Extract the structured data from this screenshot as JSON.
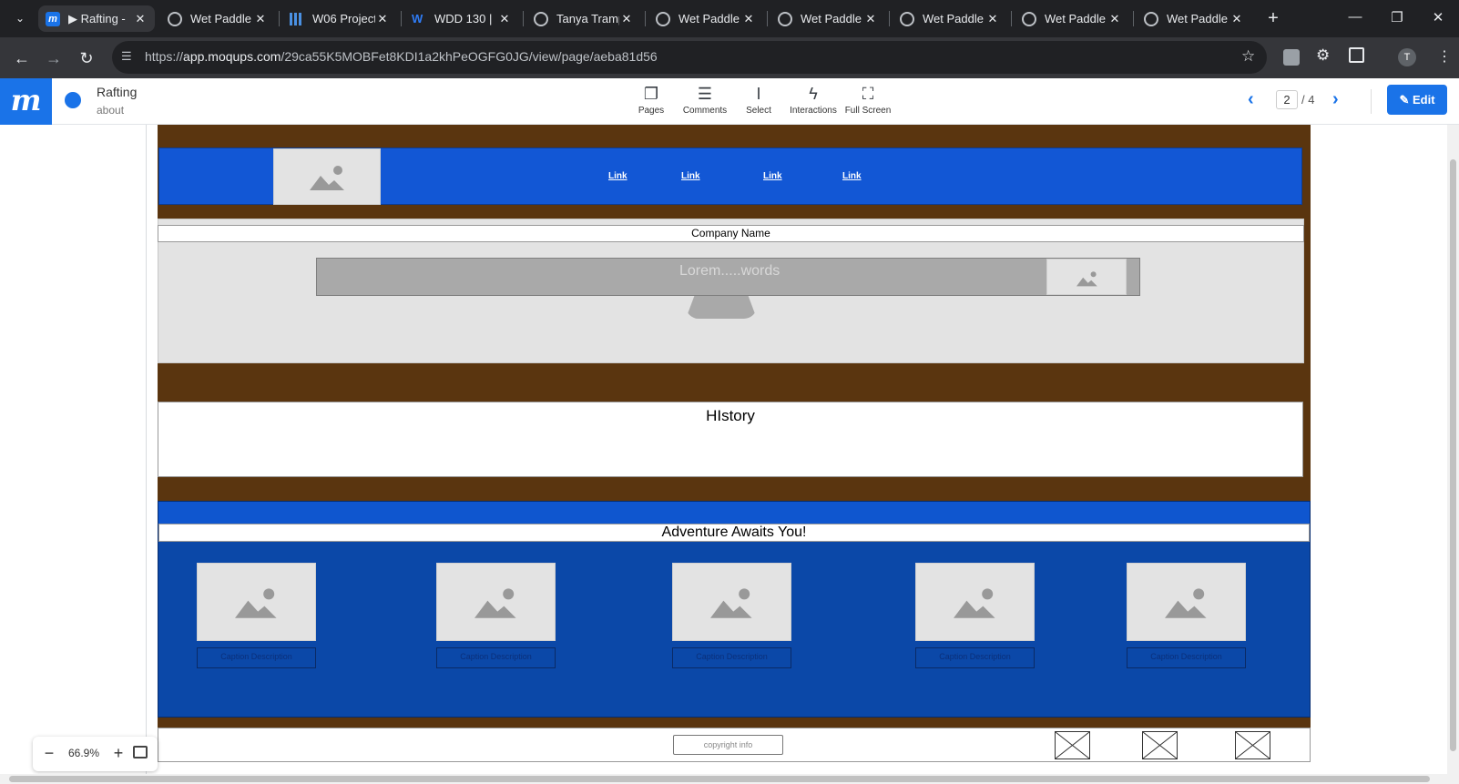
{
  "browser": {
    "tabs": [
      {
        "title": "▶ Rafting - ",
        "icon": "moqups-icon",
        "active": true
      },
      {
        "title": "Wet Paddle",
        "icon": "globe-icon"
      },
      {
        "title": "W06 Project",
        "icon": "chart-icon"
      },
      {
        "title": "WDD 130 | ",
        "icon": "w-icon"
      },
      {
        "title": "Tanya Tramp",
        "icon": "globe-icon"
      },
      {
        "title": "Wet Paddle",
        "icon": "globe-icon"
      },
      {
        "title": "Wet Paddle",
        "icon": "globe-icon"
      },
      {
        "title": "Wet Paddle",
        "icon": "globe-icon"
      },
      {
        "title": "Wet Paddle",
        "icon": "globe-icon"
      },
      {
        "title": "Wet Paddle",
        "icon": "globe-icon"
      }
    ],
    "url_scheme": "https://",
    "url_host": "app.moqups.com",
    "url_path": "/29ca55K5MOBFet8KDI1a2khPeOGFG0JG/view/page/aeba81d56",
    "profile_initial": "T"
  },
  "moqups": {
    "project_title": "Rafting",
    "page_name": "about",
    "tools": [
      "Pages",
      "Comments",
      "Select",
      "Interactions",
      "Full Screen"
    ],
    "page_current": "2",
    "page_total": "/ 4",
    "edit_label": "Edit",
    "zoom_level": "66.9%"
  },
  "mockup": {
    "nav_links": [
      "Link",
      "Link",
      "Link",
      "Link"
    ],
    "company_name": "Company Name",
    "hero_text": "Lorem.....words",
    "history_heading": "HIstory",
    "adventure_heading": "Adventure Awaits You!",
    "captions": [
      "Caption Description",
      "Caption Description",
      "Caption Description",
      "Caption Description",
      "Caption Description"
    ],
    "footer_copyright": "copyright info"
  },
  "colors": {
    "brand_blue": "#1a73e8",
    "mock_brown": "#5a350f",
    "mock_blue": "#0f56cf",
    "mock_dark_blue": "#0b48a8"
  }
}
